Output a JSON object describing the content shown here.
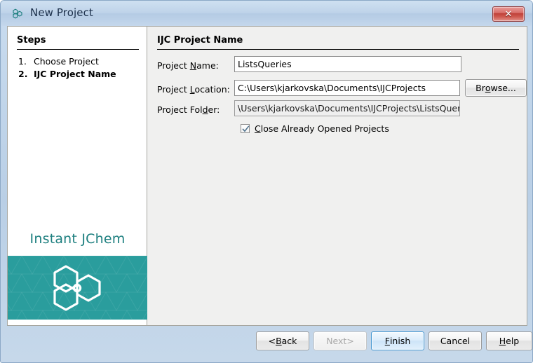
{
  "window": {
    "title": "New Project",
    "icon": "jchem-molecule-icon",
    "close_label": "✕"
  },
  "sidebar": {
    "heading": "Steps",
    "steps": [
      {
        "number": "1.",
        "label": "Choose Project",
        "active": false
      },
      {
        "number": "2.",
        "label": "IJC Project Name",
        "active": true
      }
    ],
    "brand": {
      "title": "Instant JChem",
      "logo": "jchem-molecule-logo",
      "panel_color": "#2a9d9d",
      "text_color": "#1d7f7f"
    }
  },
  "form": {
    "heading": "IJC Project Name",
    "fields": [
      {
        "label_pre": "Project ",
        "label_mnemonic": "N",
        "label_post": "ame:",
        "value": "ListsQueries",
        "readonly": false
      },
      {
        "label_pre": "Project ",
        "label_mnemonic": "L",
        "label_post": "ocation:",
        "value": "C:\\Users\\kjarkovska\\Documents\\IJCProjects",
        "readonly": false
      },
      {
        "label_pre": "Project Fol",
        "label_mnemonic": "d",
        "label_post": "er:",
        "value": "\\Users\\kjarkovska\\Documents\\IJCProjects\\ListsQueries",
        "readonly": true
      }
    ],
    "browse_button": {
      "pre": "Br",
      "mnemonic": "o",
      "post": "wse..."
    },
    "checkbox": {
      "checked": true,
      "pre": "",
      "mnemonic": "C",
      "post": "lose Already Opened Projects"
    }
  },
  "footer": {
    "buttons": [
      {
        "name": "back",
        "pre": "< ",
        "mnemonic": "B",
        "post": "ack",
        "state": "normal"
      },
      {
        "name": "next",
        "pre": "Next",
        "mnemonic": "",
        "post": " >",
        "state": "disabled"
      },
      {
        "name": "finish",
        "pre": "",
        "mnemonic": "F",
        "post": "inish",
        "state": "focused"
      },
      {
        "name": "cancel",
        "pre": "Cancel",
        "mnemonic": "",
        "post": "",
        "state": "normal"
      },
      {
        "name": "help",
        "pre": "",
        "mnemonic": "H",
        "post": "elp",
        "state": "normal"
      }
    ]
  },
  "colors": {
    "titlebar": "#bed3e9",
    "content_bg": "#f0f0ef",
    "accent_teal": "#2a9d9d",
    "close_red": "#bf4038",
    "focus_blue": "#3c93d0"
  }
}
